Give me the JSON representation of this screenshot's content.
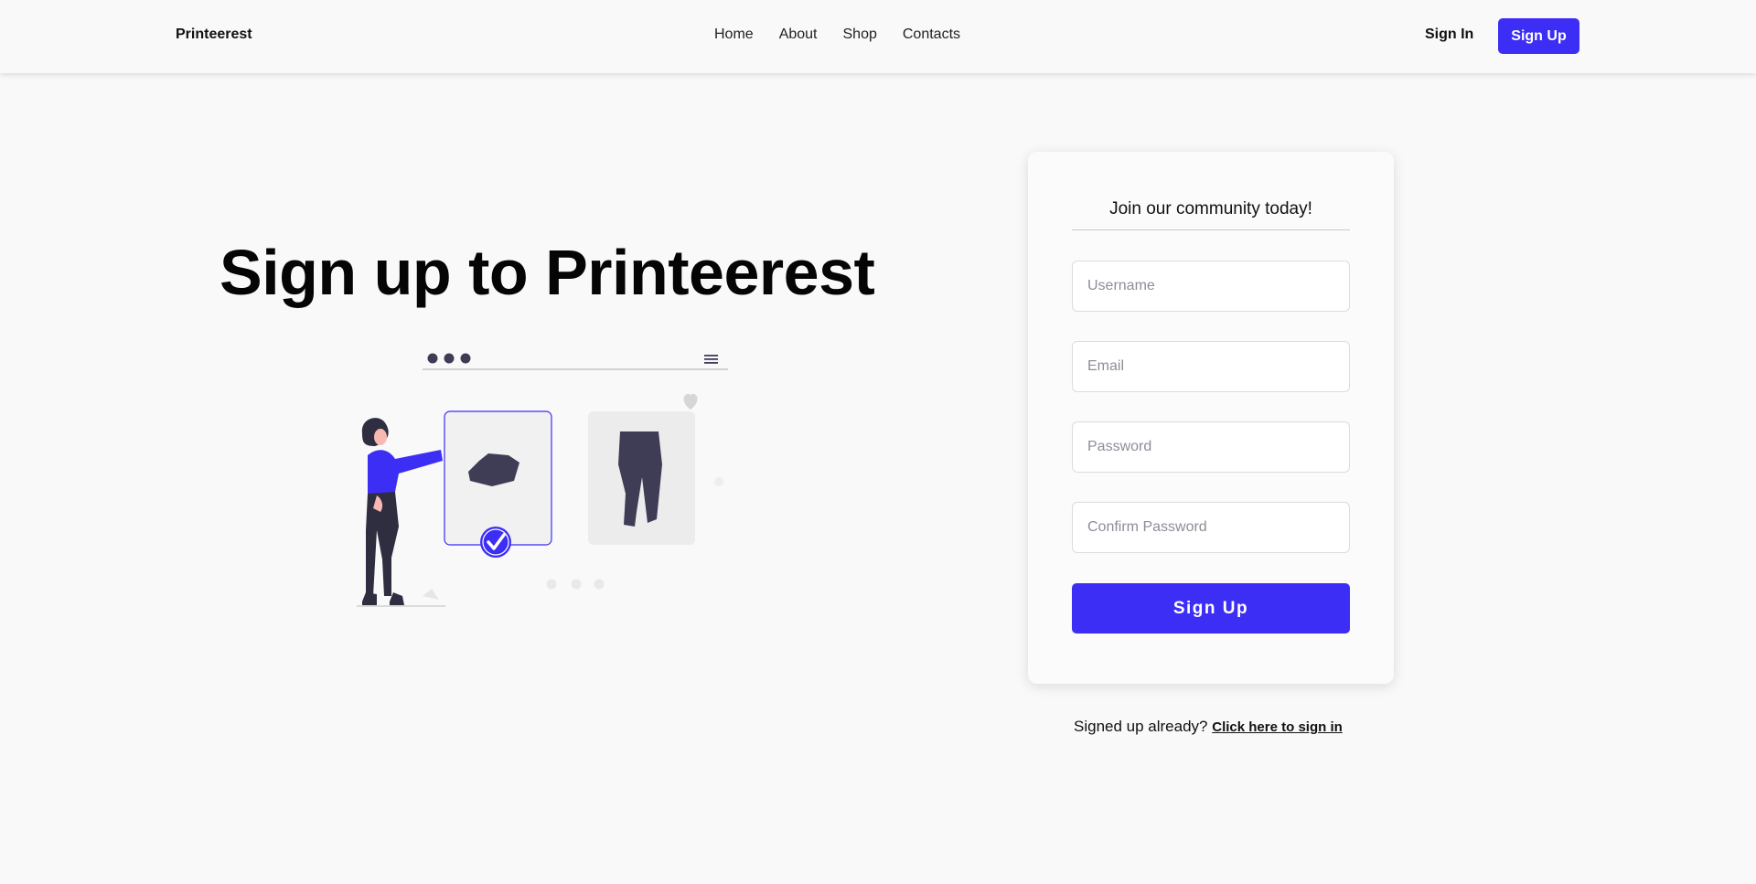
{
  "nav": {
    "brand": "Printeerest",
    "links": [
      "Home",
      "About",
      "Shop",
      "Contacts"
    ],
    "sign_in": "Sign In",
    "sign_up": "Sign Up"
  },
  "hero": {
    "title": "Sign up to Printeerest"
  },
  "form": {
    "heading": "Join our community today!",
    "username_placeholder": "Username",
    "email_placeholder": "Email",
    "password_placeholder": "Password",
    "confirm_password_placeholder": "Confirm Password",
    "submit_label": "Sign Up"
  },
  "footer_prompt": {
    "text": "Signed up already?",
    "link": "Click here to sign in"
  },
  "colors": {
    "accent": "#3d2ef5",
    "background": "#f9f9f9",
    "illustration_dark": "#3f3d56"
  },
  "icons": {
    "menu": "hamburger-menu-icon",
    "check": "checkmark-icon",
    "heart": "heart-icon"
  }
}
